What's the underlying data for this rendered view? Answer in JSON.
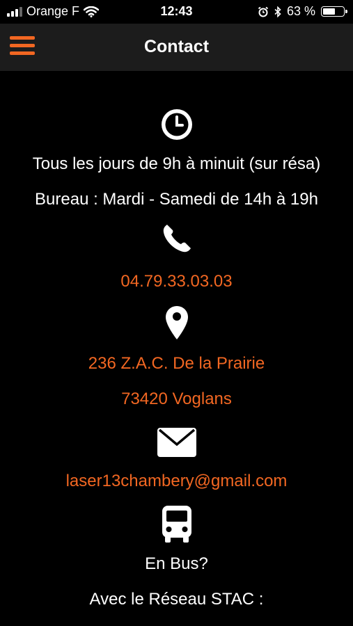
{
  "status_bar": {
    "carrier": "Orange F",
    "time": "12:43",
    "battery_percent": "63 %",
    "battery_level": 0.63,
    "icons": [
      "signal-icon",
      "wifi-icon",
      "alarm-icon",
      "bluetooth-icon",
      "battery-icon"
    ]
  },
  "header": {
    "title": "Contact",
    "menu_icon": "hamburger-menu-icon"
  },
  "contact": {
    "hours_icon": "clock-icon",
    "hours_line1": "Tous les jours de 9h à minuit (sur résa)",
    "hours_line2": "Bureau : Mardi - Samedi de 14h à 19h",
    "phone_icon": "phone-icon",
    "phone": "04.79.33.03.03",
    "location_icon": "map-pin-icon",
    "address_line1": "236 Z.A.C. De la Prairie",
    "address_line2": "73420 Voglans",
    "email_icon": "envelope-icon",
    "email": "laser13chambery@gmail.com",
    "bus_icon": "bus-icon",
    "bus_title": "En Bus?",
    "bus_network": "Avec le Réseau STAC :"
  },
  "colors": {
    "accent": "#f26722",
    "background": "#000000",
    "header_bg": "#1c1c1c"
  }
}
